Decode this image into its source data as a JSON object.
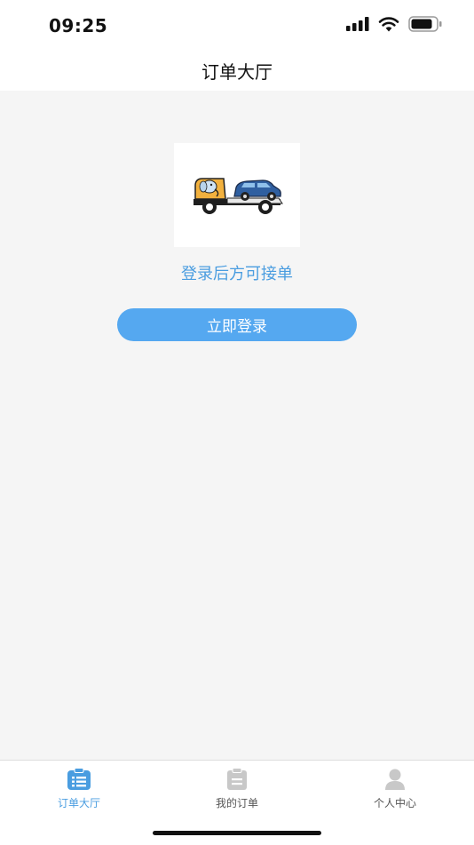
{
  "status_bar": {
    "time": "09:25",
    "icons": [
      "cellular-signal-icon",
      "wifi-icon",
      "battery-icon"
    ]
  },
  "nav": {
    "title": "订单大厅"
  },
  "main": {
    "illustration": "tow-truck-with-car-illustration",
    "hint": "登录后方可接单",
    "login_button": "立即登录"
  },
  "tab_bar": {
    "active_color": "#4a9de0",
    "inactive_color": "#c8c8c8",
    "tabs": [
      {
        "label": "订单大厅",
        "icon": "order-list-icon",
        "active": true
      },
      {
        "label": "我的订单",
        "icon": "clipboard-icon",
        "active": false
      },
      {
        "label": "个人中心",
        "icon": "user-icon",
        "active": false
      }
    ]
  },
  "colors": {
    "accent": "#55a8f0",
    "background": "#f5f5f5"
  }
}
